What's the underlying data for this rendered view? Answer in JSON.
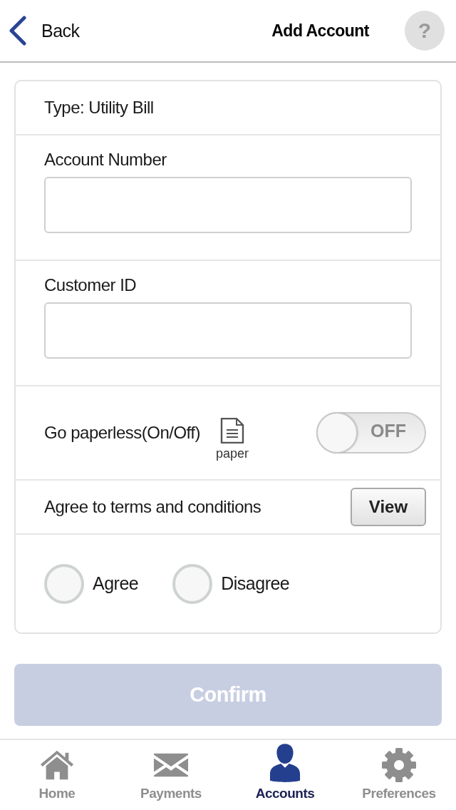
{
  "header": {
    "back": "Back",
    "title": "Add Account",
    "help": "?"
  },
  "form": {
    "type_label": "Type: Utility Bill",
    "fields": [
      {
        "label": "Account Number"
      },
      {
        "label": "Customer ID"
      }
    ],
    "paperless": {
      "label": "Go paperless(On/Off)",
      "icon_caption": "paper",
      "toggle": {
        "on": false,
        "text": "OFF"
      }
    },
    "terms": {
      "label": "Agree to terms and conditions",
      "button": "View"
    },
    "agreement": {
      "options": [
        {
          "label": "Agree",
          "selected": false
        },
        {
          "label": "Disagree",
          "selected": false
        }
      ]
    }
  },
  "confirm": {
    "label": "Confirm",
    "disabled": true
  },
  "tab_bar": [
    {
      "kind": "home",
      "label": "Home",
      "selected": false
    },
    {
      "kind": "payments",
      "label": "Payments",
      "selected": false
    },
    {
      "kind": "accounts",
      "label": "Accounts",
      "selected": true
    },
    {
      "kind": "preferences",
      "label": "Preferences",
      "selected": false
    }
  ]
}
